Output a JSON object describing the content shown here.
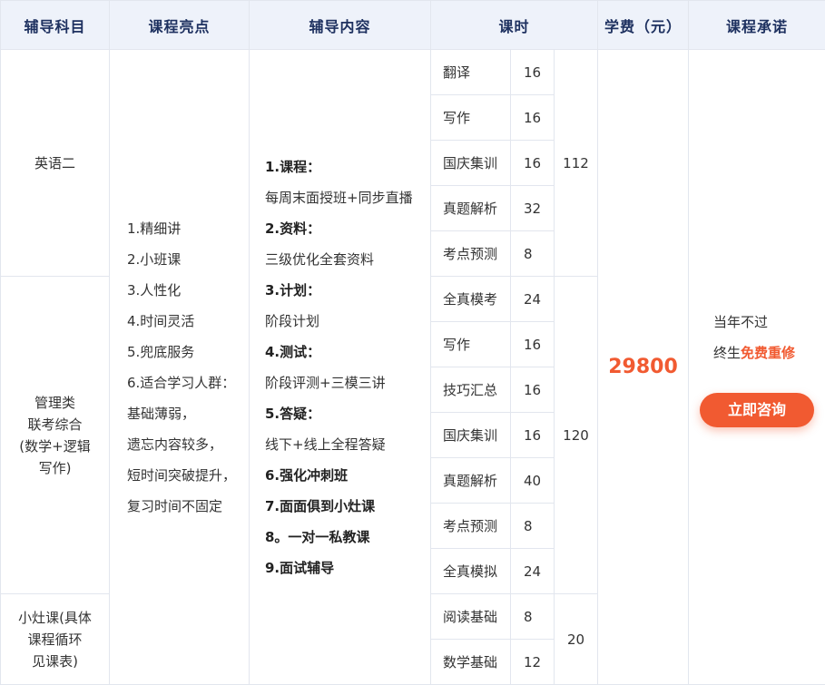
{
  "headers": [
    "辅导科目",
    "课程亮点",
    "辅导内容",
    "课时",
    "学费（元）",
    "课程承诺"
  ],
  "subjects": [
    "英语二",
    "管理类\n联考综合\n(数学+逻辑\n写作)",
    "小灶课(具体\n课程循环\n见课表)"
  ],
  "highlights": [
    "1.精细讲",
    "2.小班课",
    "3.人性化",
    "4.时间灵活",
    "5.兜底服务",
    "6.适合学习人群：",
    "基础薄弱，",
    "遗忘内容较多，",
    "短时间突破提升，",
    "复习时间不固定"
  ],
  "content": [
    {
      "text": "1.课程：",
      "bold": true
    },
    {
      "text": "每周末面授班+同步直播",
      "bold": false
    },
    {
      "text": "2.资料：",
      "bold": true
    },
    {
      "text": "三级优化全套资料",
      "bold": false
    },
    {
      "text": "3.计划：",
      "bold": true
    },
    {
      "text": "阶段计划",
      "bold": false
    },
    {
      "text": "4.测试：",
      "bold": true
    },
    {
      "text": "阶段评测+三模三讲",
      "bold": false
    },
    {
      "text": "5.答疑：",
      "bold": true
    },
    {
      "text": "线下+线上全程答疑",
      "bold": false
    },
    {
      "text": "6.强化冲刺班",
      "bold": true
    },
    {
      "text": "7.面面俱到小灶课",
      "bold": true
    },
    {
      "text": "8。一对一私教课",
      "bold": true
    },
    {
      "text": "9.面试辅导",
      "bold": true
    }
  ],
  "lessons": [
    {
      "name": "翻译",
      "hours": "16"
    },
    {
      "name": "写作",
      "hours": "16"
    },
    {
      "name": "国庆集训",
      "hours": "16"
    },
    {
      "name": "真题解析",
      "hours": "32"
    },
    {
      "name": "考点预测",
      "hours": "8"
    },
    {
      "name": "全真模考",
      "hours": "24"
    },
    {
      "name": "写作",
      "hours": "16"
    },
    {
      "name": "技巧汇总",
      "hours": "16"
    },
    {
      "name": "国庆集训",
      "hours": "16"
    },
    {
      "name": "真题解析",
      "hours": "40"
    },
    {
      "name": "考点预测",
      "hours": "8"
    },
    {
      "name": "全真模拟",
      "hours": "24"
    },
    {
      "name": "阅读基础",
      "hours": "8"
    },
    {
      "name": "数学基础",
      "hours": "12"
    }
  ],
  "totals": [
    "112",
    "120",
    "20"
  ],
  "fee": "29800",
  "promise": {
    "line1": "当年不过",
    "line2_prefix": "终生",
    "line2_highlight": "免费重修",
    "button": "立即咨询"
  }
}
